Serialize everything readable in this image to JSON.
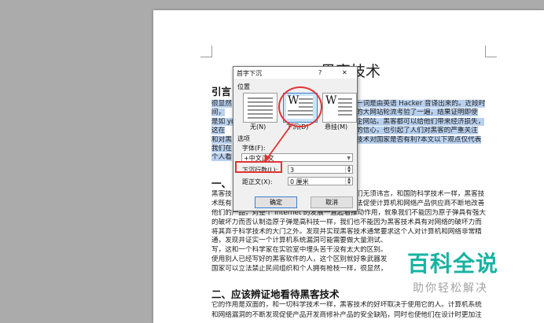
{
  "document": {
    "title": "黑客技术",
    "section1_heading": "引言",
    "section2_marker": "一、",
    "section3_heading": "二、应该辨证地看待黑客技术",
    "highlighted_lines": [
      "很显然",
      "间，",
      "是如 yo",
      "这在",
      "和对黑",
      "我们在",
      "个人看"
    ],
    "highlighted_right_lines": [
      "一词是由英语 Hacker 音译出来的。近段时",
      "的大网站轮流考验了一遍，结果证明即使",
      "企网站。黑客都可以给他们带来经济损失，",
      "的信心，也引起了人们对黑客的严重关注",
      "技术对国家是否有利?本文以下观点仅代表"
    ],
    "body_lines": [
      "黑客技",
      "术既有",
      "他们的产品，对整个 Internet 的发展一直起着推动作用，就象我们不能因为原子弹具有强大",
      "的破坏力而否认制造原子弹是高科技一样，我们也不能因为黑客技术具有对网络的破坏力而",
      "将其弃于科学技术的大门之外。发现并实现黑客技术通常要求这个人对计算机和网络非常精",
      "通，发现并证实一个计算机系统漏洞可能需要做大量测试、",
      "写，这和一个科学家在实验室中埋头苦干没有太大的区别。",
      "使用别人已经写好的黑客软件的人，这个区别就好象武器发",
      "国家可以立法禁止民间组织和个人拥有枪枝一样，很显然，"
    ],
    "body_right_lines": [
      "们无须讳言，和国防科学技术一样，黑客技",
      "法促使计算机和网络产品供应商不断地改善"
    ],
    "section3_lines": [
      "它的作用是双面的，和一切科学技术一样，黑客技术的好坏取决于使用它的人。计算机系统",
      "和网络漏洞的不断发现促使产品开发商修补产品的安全缺陷，同时也使他们在设计时更加注"
    ]
  },
  "dialog": {
    "title": "首字下沉",
    "help": "?",
    "close": "✕",
    "position_label": "位置",
    "options": [
      {
        "label": "无(N)",
        "glyph": ""
      },
      {
        "label": "下沉(D)",
        "glyph": "W"
      },
      {
        "label": "悬挂(M)",
        "glyph": "W"
      }
    ],
    "options_section_label": "选项",
    "font_label": "字体(F):",
    "font_value": "+中文正文",
    "lines_label": "下沉行数(L):",
    "lines_value": "3",
    "distance_label": "距正文(X):",
    "distance_value": "0 厘米",
    "ok_label": "确定",
    "cancel_label": "取消"
  },
  "watermark": {
    "brand": "百科全说",
    "tagline": "助你轻松解决"
  },
  "colors": {
    "selection": "#b8d0ee",
    "annotation_red": "#e23333",
    "watermark_teal": "#17b3a2"
  }
}
